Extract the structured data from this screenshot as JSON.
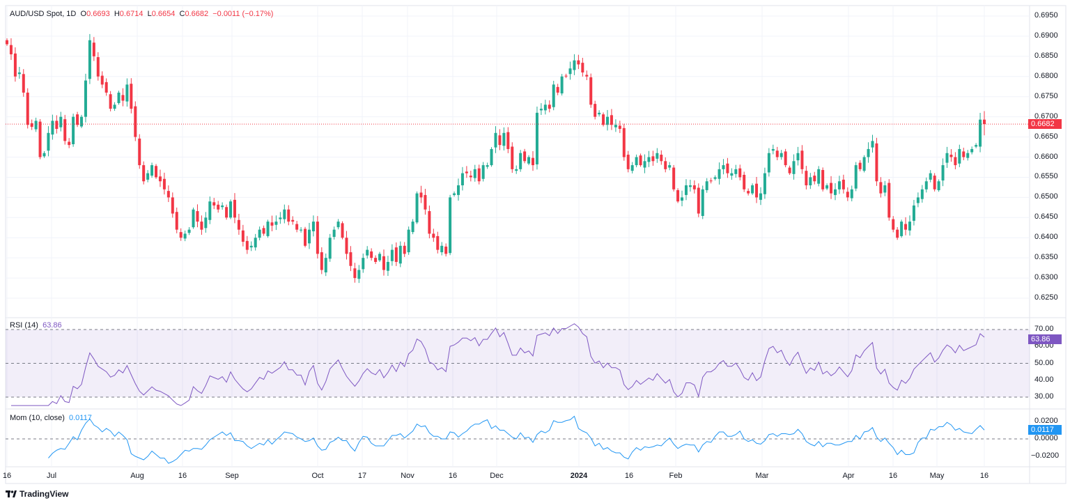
{
  "header": {
    "symbol": "AUD/USD Spot, 1D",
    "o_label": "O",
    "o": "0.6693",
    "h_label": "H",
    "h": "0.6714",
    "l_label": "L",
    "l": "0.6654",
    "c_label": "C",
    "c": "0.6682",
    "change": "−0.0011 (−0.17%)"
  },
  "rsi": {
    "label": "RSI (14)",
    "value": "63.86",
    "color": "#7e57c2"
  },
  "mom": {
    "label": "Mom (10, close)",
    "value": "0.0117",
    "color": "#2196f3"
  },
  "last_price": "0.6682",
  "colors": {
    "up": "#22ab94",
    "down": "#f23645"
  },
  "brand": "TradingView",
  "chart_data": {
    "type": "candlestick",
    "title": "AUD/USD Spot, 1D",
    "price_ticks": [
      "0.6950",
      "0.6900",
      "0.6850",
      "0.6800",
      "0.6750",
      "0.6700",
      "0.6650",
      "0.6600",
      "0.6550",
      "0.6500",
      "0.6450",
      "0.6400",
      "0.6350",
      "0.6300",
      "0.6250"
    ],
    "ylim": [
      0.622,
      0.696
    ],
    "rsi_ticks": [
      "70.00",
      "60.00",
      "50.00",
      "40.00",
      "30.00"
    ],
    "mom_ticks": [
      "0.0200",
      "0.0000",
      "−0.0200"
    ],
    "x_ticks": [
      "16",
      "Jul",
      "Aug",
      "16",
      "Sep",
      "Oct",
      "17",
      "Nov",
      "16",
      "Dec",
      "2024",
      "16",
      "Feb",
      "Mar",
      "Apr",
      "16",
      "May",
      "16"
    ],
    "last_candle": {
      "o": 0.6693,
      "h": 0.6714,
      "l": 0.6654,
      "c": 0.6682
    },
    "closes": [
      0.688,
      0.6855,
      0.68,
      0.681,
      0.676,
      0.668,
      0.6675,
      0.669,
      0.66,
      0.661,
      0.666,
      0.669,
      0.667,
      0.67,
      0.664,
      0.663,
      0.67,
      0.668,
      0.67,
      0.679,
      0.689,
      0.685,
      0.68,
      0.678,
      0.676,
      0.672,
      0.673,
      0.676,
      0.674,
      0.678,
      0.672,
      0.665,
      0.658,
      0.654,
      0.656,
      0.658,
      0.655,
      0.654,
      0.652,
      0.65,
      0.646,
      0.642,
      0.64,
      0.641,
      0.642,
      0.647,
      0.644,
      0.642,
      0.645,
      0.649,
      0.648,
      0.647,
      0.648,
      0.645,
      0.649,
      0.645,
      0.642,
      0.639,
      0.637,
      0.638,
      0.64,
      0.642,
      0.641,
      0.644,
      0.643,
      0.644,
      0.645,
      0.647,
      0.644,
      0.644,
      0.642,
      0.642,
      0.638,
      0.642,
      0.644,
      0.636,
      0.632,
      0.635,
      0.64,
      0.642,
      0.644,
      0.64,
      0.636,
      0.633,
      0.63,
      0.632,
      0.635,
      0.637,
      0.635,
      0.634,
      0.636,
      0.632,
      0.634,
      0.637,
      0.634,
      0.638,
      0.636,
      0.642,
      0.644,
      0.651,
      0.65,
      0.647,
      0.641,
      0.64,
      0.637,
      0.638,
      0.636,
      0.65,
      0.651,
      0.653,
      0.656,
      0.656,
      0.655,
      0.657,
      0.654,
      0.658,
      0.658,
      0.662,
      0.666,
      0.663,
      0.666,
      0.662,
      0.657,
      0.657,
      0.661,
      0.659,
      0.66,
      0.658,
      0.671,
      0.672,
      0.673,
      0.672,
      0.678,
      0.676,
      0.68,
      0.68,
      0.682,
      0.684,
      0.683,
      0.681,
      0.68,
      0.673,
      0.67,
      0.671,
      0.668,
      0.67,
      0.668,
      0.668,
      0.667,
      0.66,
      0.657,
      0.658,
      0.66,
      0.658,
      0.659,
      0.66,
      0.659,
      0.661,
      0.659,
      0.657,
      0.658,
      0.652,
      0.649,
      0.65,
      0.653,
      0.653,
      0.652,
      0.646,
      0.652,
      0.654,
      0.654,
      0.655,
      0.657,
      0.658,
      0.656,
      0.656,
      0.657,
      0.655,
      0.652,
      0.651,
      0.653,
      0.65,
      0.651,
      0.656,
      0.661,
      0.662,
      0.66,
      0.661,
      0.658,
      0.656,
      0.659,
      0.661,
      0.657,
      0.653,
      0.655,
      0.654,
      0.657,
      0.652,
      0.653,
      0.651,
      0.652,
      0.654,
      0.652,
      0.65,
      0.652,
      0.658,
      0.657,
      0.66,
      0.662,
      0.664,
      0.654,
      0.651,
      0.653,
      0.645,
      0.642,
      0.64,
      0.644,
      0.642,
      0.644,
      0.648,
      0.65,
      0.652,
      0.654,
      0.656,
      0.652,
      0.654,
      0.658,
      0.661,
      0.66,
      0.658,
      0.662,
      0.66,
      0.661,
      0.662,
      0.663,
      0.6693,
      0.6682
    ]
  }
}
